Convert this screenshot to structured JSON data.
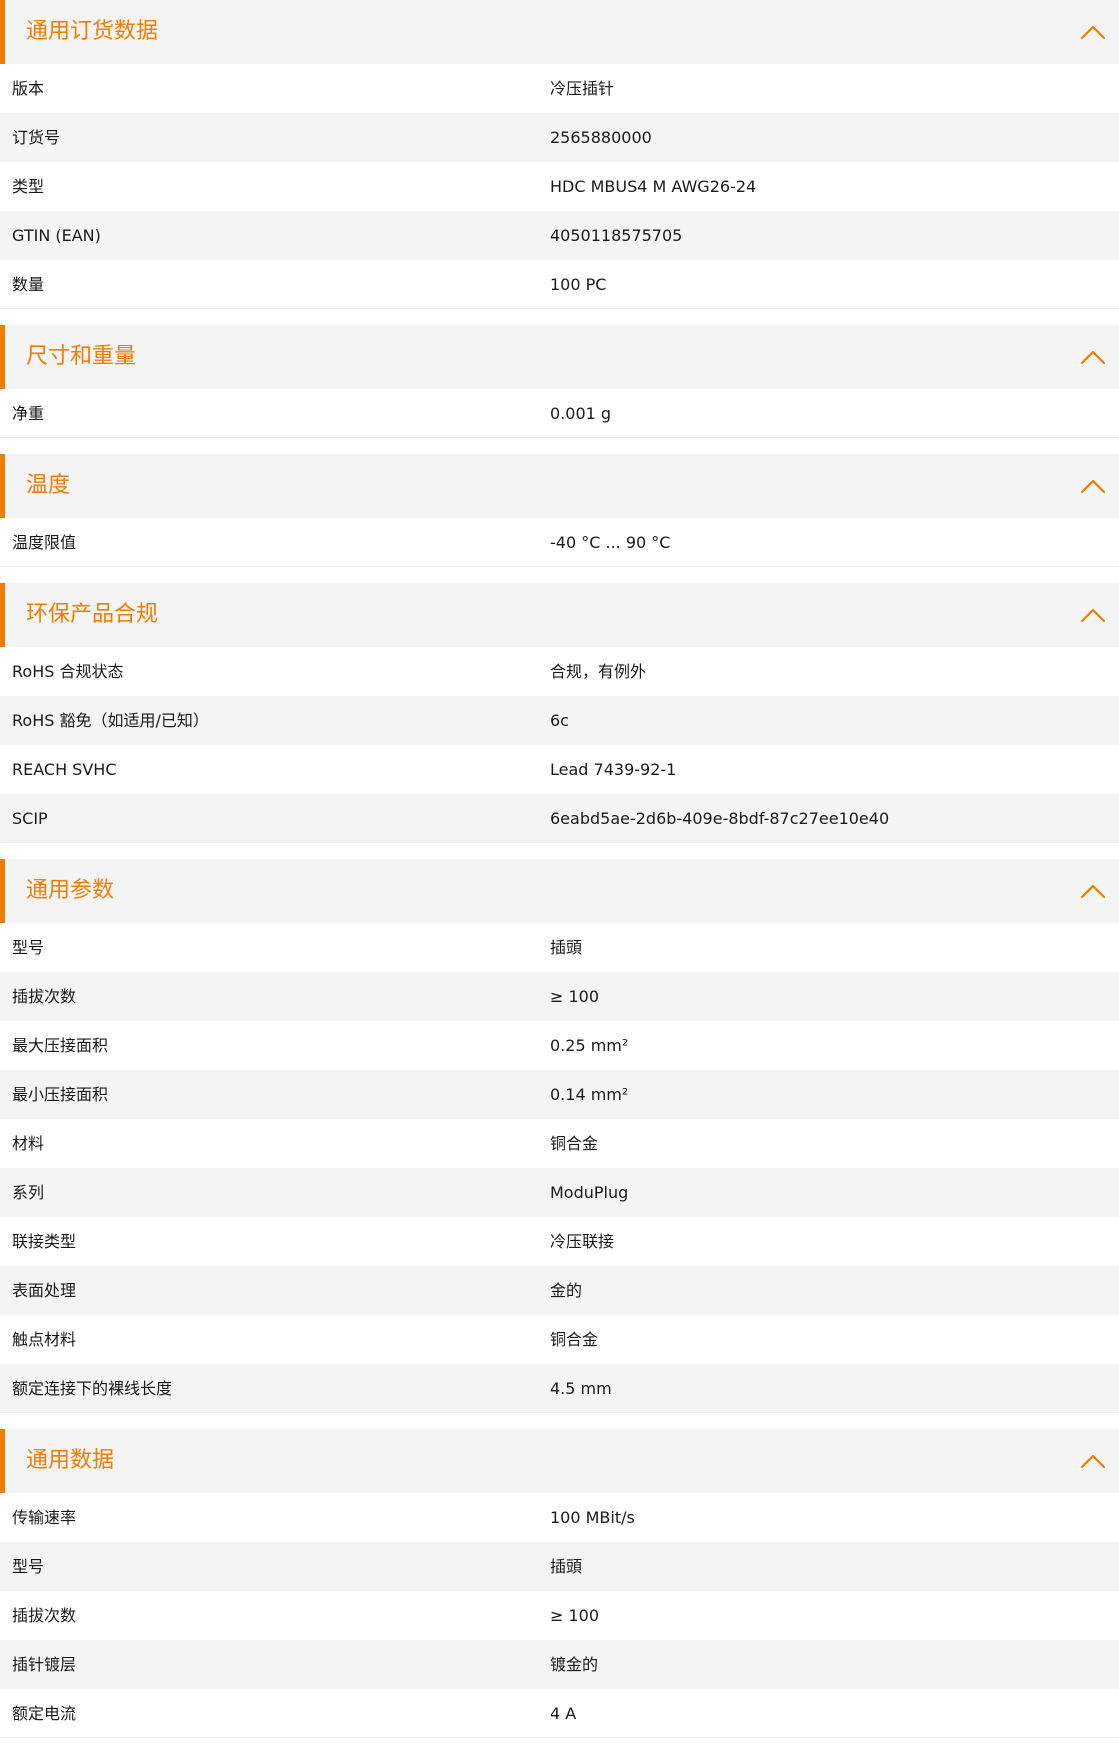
{
  "theme": {
    "accent": "#f07d00",
    "header_bg": "#f4f4f4",
    "stripe_bg": "#f4f4f4"
  },
  "sections": [
    {
      "title": "通用订货数据",
      "expanded": true,
      "icon": "chevron-up-icon",
      "rows": [
        {
          "label": "版本",
          "value": "冷压插针"
        },
        {
          "label": "订货号",
          "value": "2565880000"
        },
        {
          "label": "类型",
          "value": "HDC MBUS4 M AWG26-24"
        },
        {
          "label": "GTIN (EAN)",
          "value": "4050118575705"
        },
        {
          "label": "数量",
          "value": "100  PC"
        }
      ]
    },
    {
      "title": "尺寸和重量",
      "expanded": true,
      "icon": "chevron-up-icon",
      "rows": [
        {
          "label": "净重",
          "value": "0.001  g"
        }
      ]
    },
    {
      "title": "温度",
      "expanded": true,
      "icon": "chevron-up-icon",
      "rows": [
        {
          "label": "温度限值",
          "value": "-40 °C ... 90 °C"
        }
      ]
    },
    {
      "title": "环保产品合规",
      "expanded": true,
      "icon": "chevron-up-icon",
      "rows": [
        {
          "label": "RoHS 合规状态",
          "value": "合规，有例外"
        },
        {
          "label": "RoHS 豁免（如适用/已知）",
          "value": "6c"
        },
        {
          "label": "REACH SVHC",
          "value": "Lead 7439-92-1"
        },
        {
          "label": "SCIP",
          "value": "6eabd5ae-2d6b-409e-8bdf-87c27ee10e40"
        }
      ]
    },
    {
      "title": "通用参数",
      "expanded": true,
      "icon": "chevron-up-icon",
      "rows": [
        {
          "label": "型号",
          "value": "插頭"
        },
        {
          "label": "插拔次数",
          "value": "≥ 100"
        },
        {
          "label": "最大压接面积",
          "value": "0.25  mm²"
        },
        {
          "label": "最小压接面积",
          "value": "0.14  mm²"
        },
        {
          "label": "材料",
          "value": "铜合金"
        },
        {
          "label": "系列",
          "value": "ModuPlug"
        },
        {
          "label": "联接类型",
          "value": "冷压联接"
        },
        {
          "label": "表面处理",
          "value": "金的"
        },
        {
          "label": "触点材料",
          "value": "铜合金"
        },
        {
          "label": "额定连接下的裸线长度",
          "value": "4.5  mm"
        }
      ]
    },
    {
      "title": "通用数据",
      "expanded": true,
      "icon": "chevron-up-icon",
      "rows": [
        {
          "label": "传输速率",
          "value": "100 MBit/s"
        },
        {
          "label": "型号",
          "value": "插頭"
        },
        {
          "label": "插拔次数",
          "value": "≥ 100"
        },
        {
          "label": "插针镀层",
          "value": "镀金的"
        },
        {
          "label": "额定电流",
          "value": "4  A"
        }
      ]
    }
  ]
}
